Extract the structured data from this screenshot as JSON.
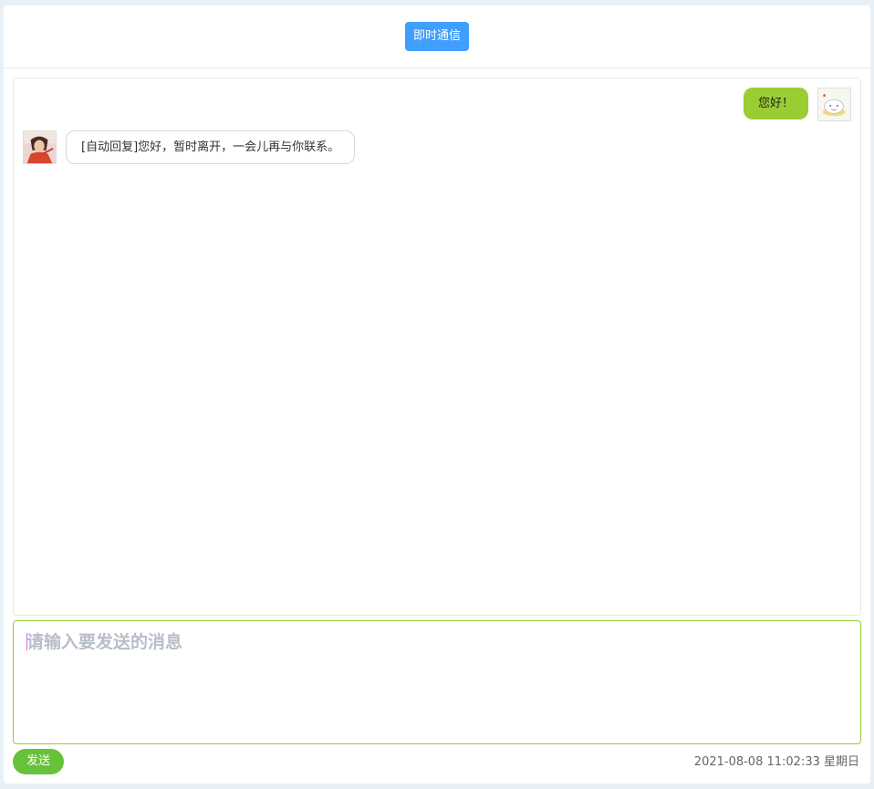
{
  "header": {
    "title_button": "即时通信"
  },
  "messages": [
    {
      "sender": "me",
      "text": "您好！",
      "avatar": "cartoon-avatar"
    },
    {
      "sender": "other",
      "text": "[自动回复]您好，暂时离开，一会儿再与你联系。",
      "avatar": "portrait-avatar"
    }
  ],
  "composer": {
    "placeholder": "请输入要发送的消息",
    "value": "",
    "send_label": "发送"
  },
  "status": {
    "datetime": "2021-08-08 11:02:33 星期日"
  },
  "colors": {
    "primary": "#409eff",
    "my_bubble": "#9acd32",
    "send_button": "#67c23a",
    "input_border": "#9acd32"
  }
}
